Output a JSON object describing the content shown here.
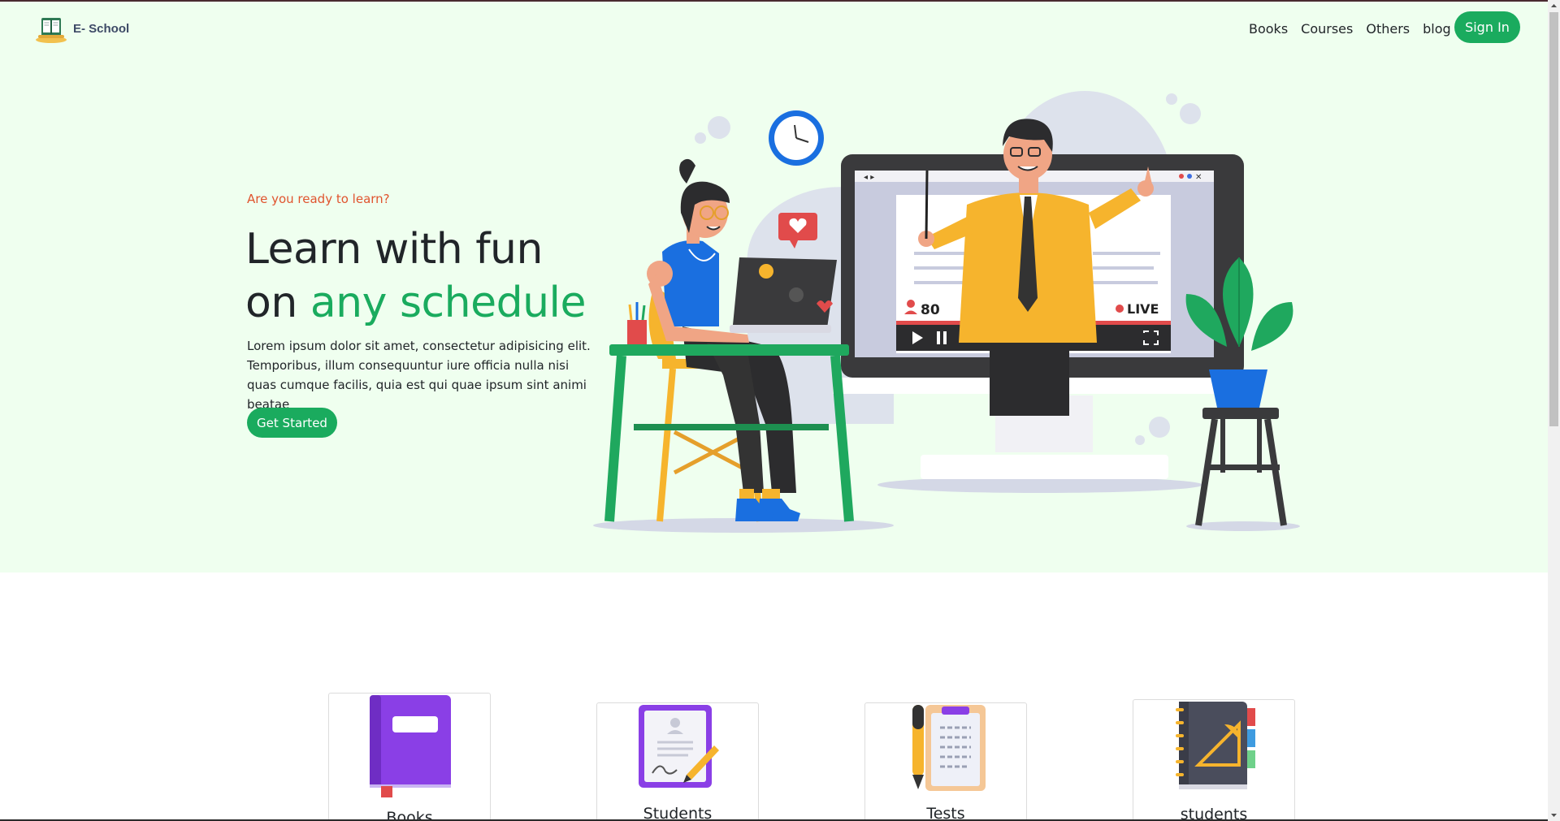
{
  "brand": {
    "name": "E- School",
    "logo_icon": "school-books-logo-icon"
  },
  "nav": {
    "links": [
      "Books",
      "Courses",
      "Others",
      "blog"
    ],
    "sign_in": "Sign In"
  },
  "hero": {
    "eyebrow": "Are you ready to learn?",
    "headline_line1": "Learn with fun",
    "headline_line2_prefix": "on ",
    "headline_line2_accent": "any schedule",
    "body": "Lorem ipsum dolor sit amet, consectetur adipisicing elit. Temporibus, illum consequuntur iure officia nulla nisi quas cumque facilis, quia est qui quae ipsum sint animi beatae",
    "cta": "Get Started",
    "video_viewers": "80",
    "live_label": "LIVE"
  },
  "features": [
    {
      "label": "Books",
      "icon": "book-icon"
    },
    {
      "label": "Students",
      "icon": "student-profile-icon"
    },
    {
      "label": "Tests",
      "icon": "test-clipboard-icon"
    },
    {
      "label": "students",
      "icon": "notebook-ruler-icon"
    }
  ],
  "colors": {
    "hero_bg": "#efffef",
    "accent": "#1aab5e",
    "eyebrow": "#e0542e",
    "text": "#212529"
  }
}
